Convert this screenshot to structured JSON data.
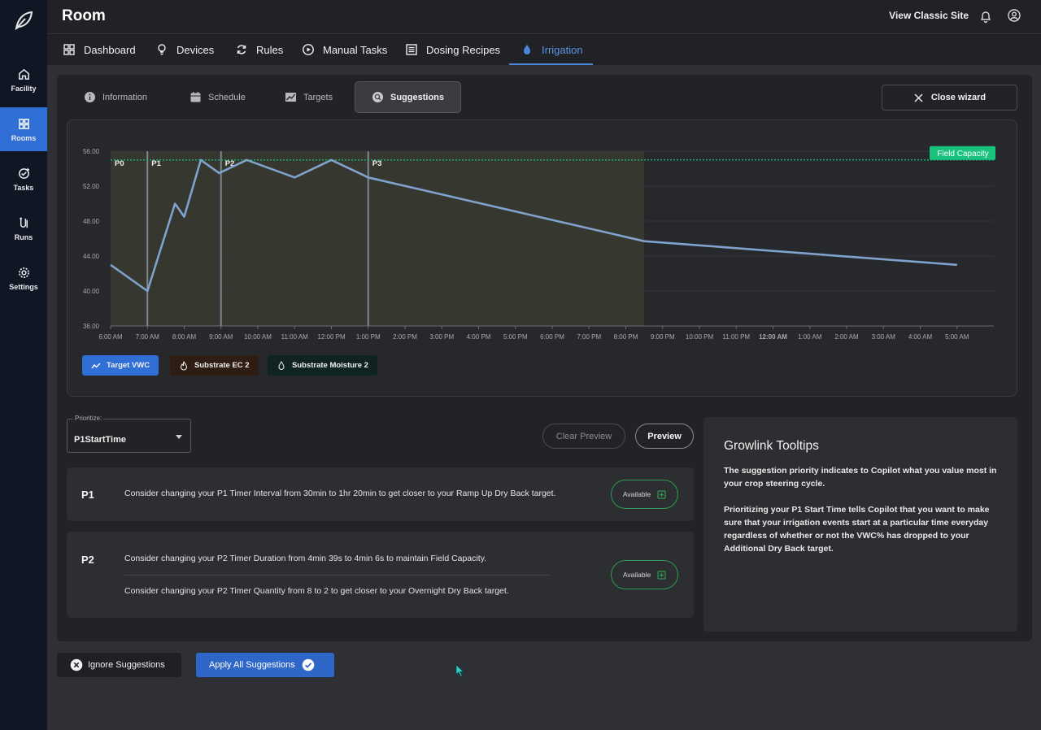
{
  "rail": {
    "items": [
      {
        "label": "Facility",
        "icon": "home-icon"
      },
      {
        "label": "Rooms",
        "icon": "grid-icon",
        "active": true
      },
      {
        "label": "Tasks",
        "icon": "task-check-icon"
      },
      {
        "label": "Runs",
        "icon": "runs-icon"
      },
      {
        "label": "Settings",
        "icon": "gear-icon"
      }
    ]
  },
  "header": {
    "title": "Room",
    "classic_link": "View Classic Site"
  },
  "nav": {
    "tabs": [
      {
        "label": "Dashboard",
        "icon": "dashboard-icon"
      },
      {
        "label": "Devices",
        "icon": "lightbulb-icon"
      },
      {
        "label": "Rules",
        "icon": "refresh-icon"
      },
      {
        "label": "Manual Tasks",
        "icon": "play-circle-icon"
      },
      {
        "label": "Dosing Recipes",
        "icon": "list-icon"
      },
      {
        "label": "Irrigation",
        "icon": "water-drop-icon",
        "active": true
      }
    ]
  },
  "wizard": {
    "tabs": [
      {
        "label": "Information",
        "icon": "info-icon"
      },
      {
        "label": "Schedule",
        "icon": "calendar-icon"
      },
      {
        "label": "Targets",
        "icon": "chart-icon"
      },
      {
        "label": "Suggestions",
        "icon": "suggestion-icon",
        "active": true
      }
    ],
    "close_label": "Close wizard"
  },
  "chart_data": {
    "type": "line",
    "y_ticks": [
      "56.00",
      "52.00",
      "48.00",
      "44.00",
      "40.00",
      "36.00"
    ],
    "ylim": [
      36,
      56
    ],
    "x_ticks": [
      "6:00 AM",
      "7:00 AM",
      "8:00 AM",
      "9:00 AM",
      "10:00 AM",
      "11:00 AM",
      "12:00 PM",
      "1:00 PM",
      "2:00 PM",
      "3:00 PM",
      "4:00 PM",
      "5:00 PM",
      "6:00 PM",
      "7:00 PM",
      "8:00 PM",
      "9:00 PM",
      "10:00 PM",
      "11:00 PM",
      "12:00 AM",
      "1:00 AM",
      "2:00 AM",
      "3:00 AM",
      "4:00 AM",
      "5:00 AM"
    ],
    "bold_x_tick": "12:00 AM",
    "field_capacity": {
      "label": "Field Capacity",
      "value": 55
    },
    "phase_labels": [
      {
        "label": "P0",
        "hour": 6.0
      },
      {
        "label": "P1",
        "hour": 7.0
      },
      {
        "label": "P2",
        "hour": 9.0
      },
      {
        "label": "P3",
        "hour": 13.0
      }
    ],
    "shaded_range_hours": [
      6.0,
      20.5
    ],
    "series": [
      {
        "color": "#7fa3cc",
        "points": [
          [
            6.0,
            43.0
          ],
          [
            7.0,
            40.0
          ],
          [
            7.75,
            50.0
          ],
          [
            8.0,
            48.5
          ],
          [
            8.45,
            55.0
          ],
          [
            8.95,
            53.5
          ],
          [
            9.7,
            55.0
          ],
          [
            11.0,
            53.0
          ],
          [
            12.0,
            55.0
          ],
          [
            13.0,
            53.0
          ],
          [
            20.5,
            45.7
          ],
          [
            29.0,
            43.0
          ]
        ]
      }
    ],
    "legend": [
      {
        "label": "Target VWC",
        "bg": "#2f6fd6",
        "icon": "trend-icon"
      },
      {
        "label": "Substrate EC 2",
        "bg": "#2e1d12",
        "icon": "flame-icon"
      },
      {
        "label": "Substrate Moisture 2",
        "bg": "#0f2421",
        "icon": "drop-icon"
      }
    ]
  },
  "prioritize": {
    "label": "Prioritize:",
    "value": "P1StartTime"
  },
  "actions": {
    "clear_preview": "Clear Preview",
    "preview": "Preview"
  },
  "suggestions": [
    {
      "phase": "P1",
      "lines": [
        "Consider changing your P1 Timer Interval from 30min to 1hr 20min to get closer to your Ramp Up Dry Back target."
      ],
      "status": "Available"
    },
    {
      "phase": "P2",
      "lines": [
        "Consider changing your P2 Timer Duration from 4min 39s to 4min 6s to maintain Field Capacity.",
        "Consider changing your P2 Timer Quantity from 8 to 2 to get closer to your Overnight Dry Back target."
      ],
      "status": "Available"
    }
  ],
  "tooltips": {
    "title": "Growlink Tooltips",
    "para1": "The suggestion priority indicates to Copilot what you value most in your crop steering cycle.",
    "para2": "Prioritizing your P1 Start Time tells Copilot that you want to make sure that your irrigation events start at a particular time everyday regardless of whether or not the VWC% has dropped to your Additional Dry Back target."
  },
  "bottom": {
    "ignore": "Ignore Suggestions",
    "apply": "Apply All Suggestions"
  },
  "colors": {
    "accent": "#2f6fd6",
    "field_capacity": "#19c37d",
    "available_border": "#2f9a52"
  }
}
